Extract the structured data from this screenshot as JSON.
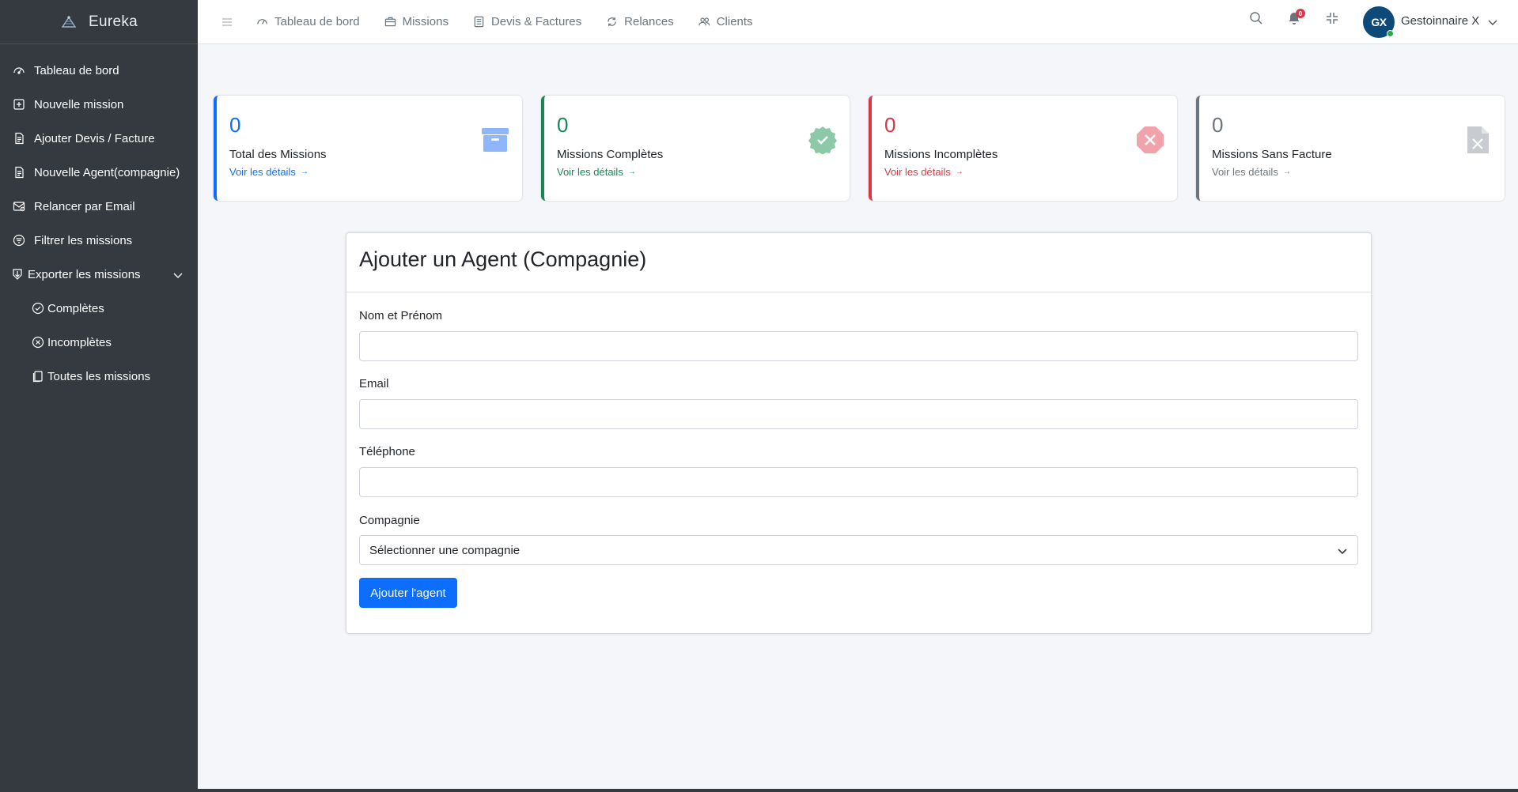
{
  "brand": {
    "name": "Eureka",
    "logo_icon": "eureka-logo"
  },
  "sidebar": {
    "items": [
      {
        "label": "Tableau de bord",
        "icon": "speedometer-icon"
      },
      {
        "label": "Nouvelle mission",
        "icon": "plus-square-icon"
      },
      {
        "label": "Ajouter Devis / Facture",
        "icon": "file-text-icon"
      },
      {
        "label": "Nouvelle Agent(compagnie)",
        "icon": "file-text-icon"
      },
      {
        "label": "Relancer par Email",
        "icon": "envelope-icon"
      },
      {
        "label": "Filtrer les missions",
        "icon": "filter-circle-icon"
      }
    ],
    "export": {
      "label": "Exporter les missions",
      "icon": "download-file-icon",
      "children": [
        {
          "label": "Complètes",
          "icon": "check-circle-icon"
        },
        {
          "label": "Incomplètes",
          "icon": "x-circle-icon"
        },
        {
          "label": "Toutes les missions",
          "icon": "files-icon"
        }
      ]
    }
  },
  "topbar": {
    "links": [
      {
        "label": "Tableau de bord",
        "icon": "speedometer-icon"
      },
      {
        "label": "Missions",
        "icon": "briefcase-icon"
      },
      {
        "label": "Devis & Factures",
        "icon": "receipt-icon"
      },
      {
        "label": "Relances",
        "icon": "refresh-icon"
      },
      {
        "label": "Clients",
        "icon": "people-icon"
      }
    ],
    "notifications_count": "0",
    "user": {
      "initials": "GX",
      "name": "Gestoinnaire X"
    }
  },
  "stats": [
    {
      "value": "0",
      "label": "Total des Missions",
      "link": "Voir les détails",
      "color": "#0d6efd",
      "icon": "archive-icon"
    },
    {
      "value": "0",
      "label": "Missions Complètes",
      "link": "Voir les détails",
      "color": "#198754",
      "icon": "check-badge-icon"
    },
    {
      "value": "0",
      "label": "Missions Incomplètes",
      "link": "Voir les détails",
      "color": "#dc3545",
      "icon": "x-octagon-icon"
    },
    {
      "value": "0",
      "label": "Missions Sans Facture",
      "link": "Voir les détails",
      "color": "#6c757d",
      "icon": "file-x-icon"
    }
  ],
  "form": {
    "title": "Ajouter un Agent (Compagnie)",
    "fields": {
      "name": {
        "label": "Nom et Prénom",
        "value": ""
      },
      "email": {
        "label": "Email",
        "value": ""
      },
      "phone": {
        "label": "Téléphone",
        "value": ""
      },
      "company": {
        "label": "Compagnie",
        "selected": "Sélectionner une compagnie"
      }
    },
    "submit_label": "Ajouter l'agent"
  }
}
